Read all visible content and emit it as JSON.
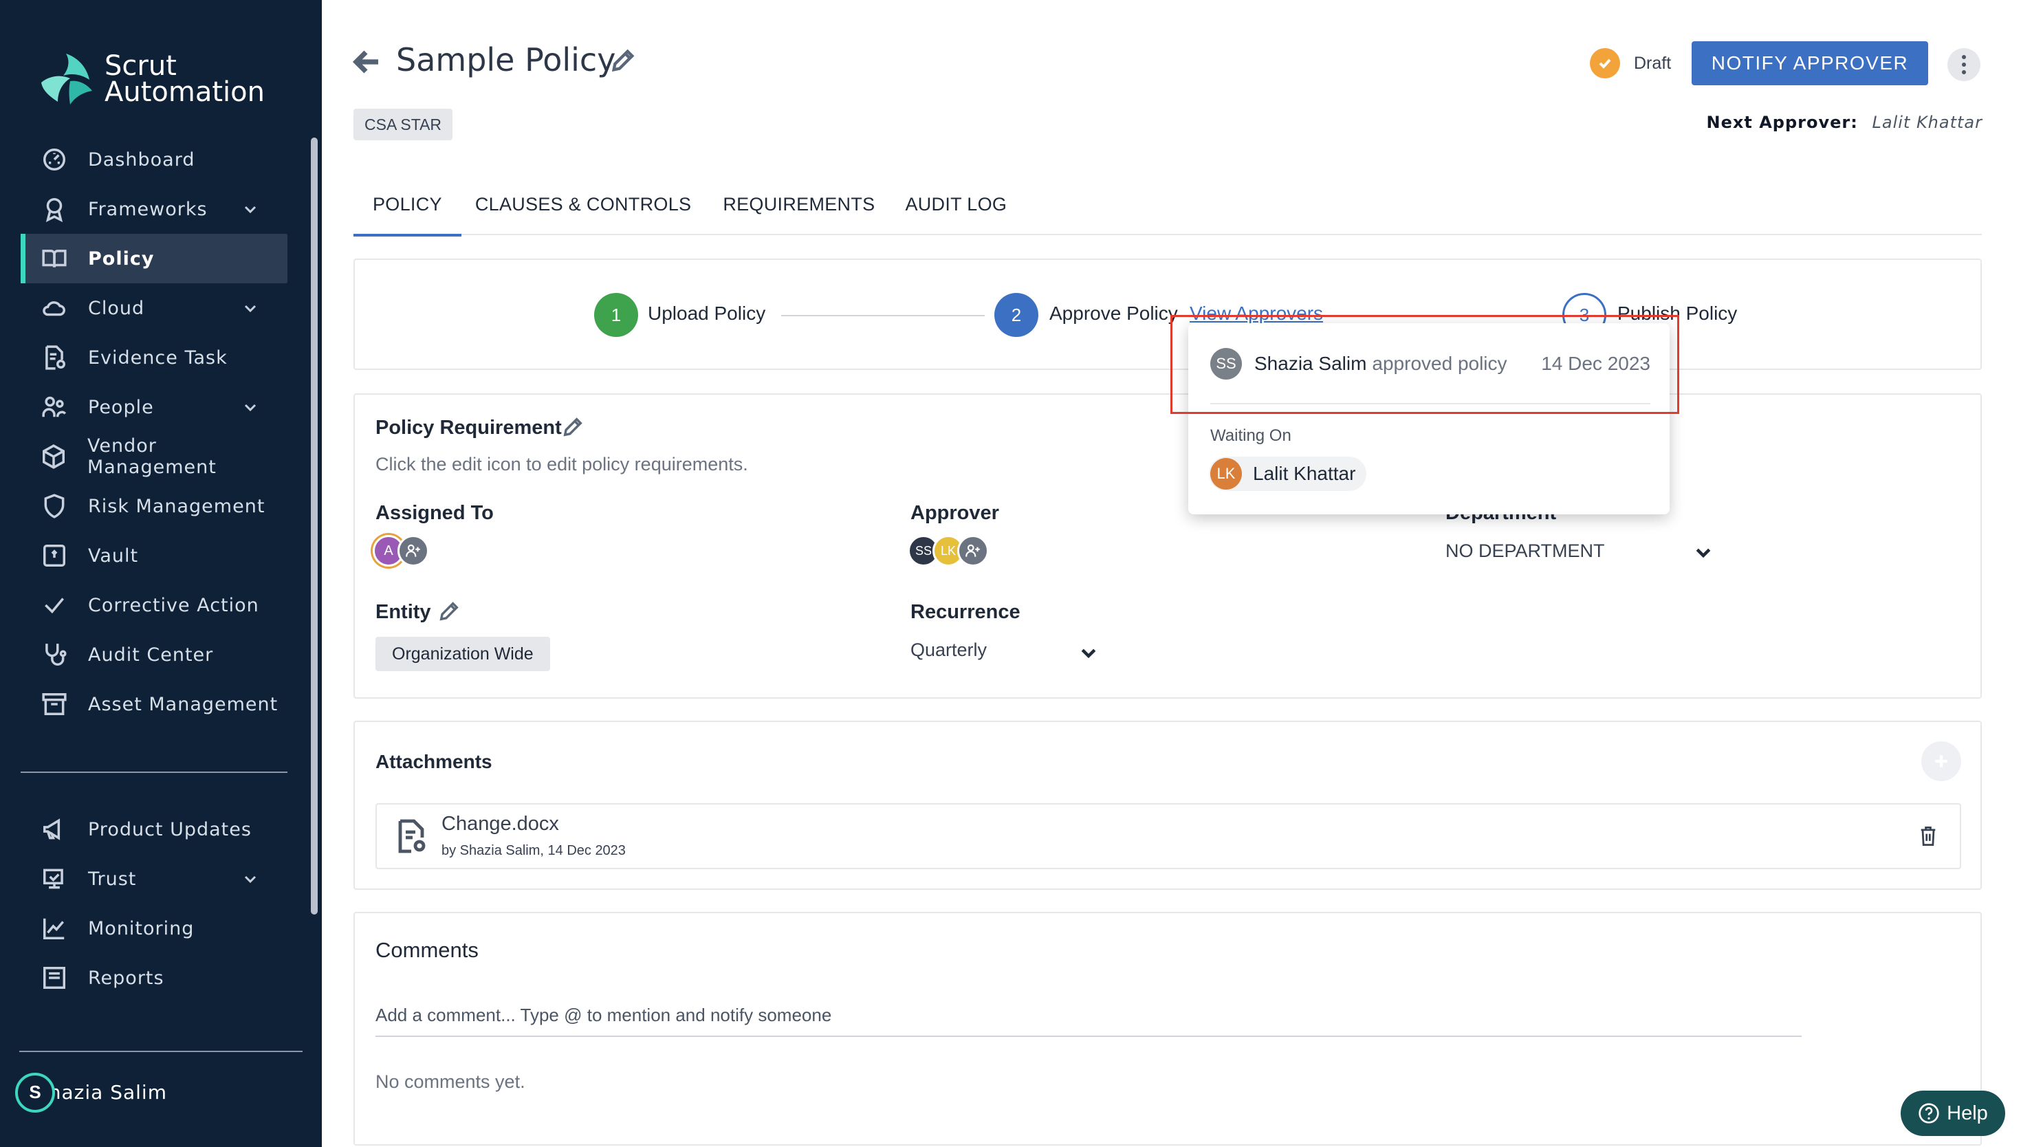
{
  "brand": {
    "line1": "Scrut",
    "line2": "Automation"
  },
  "sidebar": {
    "items": [
      {
        "label": "Dashboard",
        "icon": "dashboard-icon",
        "chevron": false,
        "active": false
      },
      {
        "label": "Frameworks",
        "icon": "award-icon",
        "chevron": true,
        "active": false
      },
      {
        "label": "Policy",
        "icon": "book-icon",
        "chevron": false,
        "active": true
      },
      {
        "label": "Cloud",
        "icon": "cloud-icon",
        "chevron": true,
        "active": false
      },
      {
        "label": "Evidence Task",
        "icon": "file-task-icon",
        "chevron": false,
        "active": false
      },
      {
        "label": "People",
        "icon": "people-icon",
        "chevron": true,
        "active": false
      },
      {
        "label": "Vendor Management",
        "icon": "box-icon",
        "chevron": false,
        "active": false
      },
      {
        "label": "Risk Management",
        "icon": "shield-icon",
        "chevron": false,
        "active": false
      },
      {
        "label": "Vault",
        "icon": "vault-icon",
        "chevron": false,
        "active": false
      },
      {
        "label": "Corrective Action",
        "icon": "check-icon",
        "chevron": false,
        "active": false
      },
      {
        "label": "Audit Center",
        "icon": "stethoscope-icon",
        "chevron": false,
        "active": false
      },
      {
        "label": "Asset Management",
        "icon": "archive-icon",
        "chevron": false,
        "active": false
      }
    ],
    "bottom_items": [
      {
        "label": "Product Updates",
        "icon": "megaphone-icon",
        "chevron": false
      },
      {
        "label": "Trust",
        "icon": "trust-icon",
        "chevron": true
      },
      {
        "label": "Monitoring",
        "icon": "chart-line-icon",
        "chevron": false
      },
      {
        "label": "Reports",
        "icon": "reports-icon",
        "chevron": false
      }
    ],
    "user": {
      "initial": "S",
      "name": "Shazia Salim"
    }
  },
  "header": {
    "title": "Sample Policy",
    "tag": "CSA STAR",
    "status": "Draft",
    "notify_label": "NOTIFY APPROVER",
    "next_approver_label": "Next Approver:",
    "next_approver_value": "Lalit Khattar"
  },
  "tabs": [
    "POLICY",
    "CLAUSES & CONTROLS",
    "REQUIREMENTS",
    "AUDIT LOG"
  ],
  "stepper": {
    "steps": [
      {
        "num": "1",
        "label": "Upload Policy",
        "state": "done",
        "color": "#3fa34d"
      },
      {
        "num": "2",
        "label": "Approve Policy",
        "state": "current",
        "color": "#3b70c3"
      },
      {
        "num": "3",
        "label": "Publish Policy",
        "state": "pending",
        "color": "#3b70c3"
      }
    ],
    "link": "View Approvers"
  },
  "requirement": {
    "title": "Policy Requirement",
    "subtitle": "Click the edit icon to edit policy requirements.",
    "assigned_to_label": "Assigned To",
    "assigned_initial": "A",
    "approver_label": "Approver",
    "approver_initials": [
      "SS",
      "LK"
    ],
    "department_label": "Department",
    "department_value": "NO DEPARTMENT",
    "entity_label": "Entity",
    "entity_value": "Organization Wide",
    "recurrence_label": "Recurrence",
    "recurrence_value": "Quarterly"
  },
  "attachments": {
    "title": "Attachments",
    "file_name": "Change.docx",
    "file_meta": "by Shazia Salim, 14 Dec 2023"
  },
  "comments": {
    "title": "Comments",
    "placeholder": "Add a comment... Type @ to mention and notify someone",
    "empty": "No comments yet."
  },
  "popup": {
    "approved_initials": "SS",
    "approved_name": "Shazia Salim",
    "approved_action": "approved policy",
    "approved_date": "14 Dec 2023",
    "waiting_label": "Waiting On",
    "waiting_initials": "LK",
    "waiting_name": "Lalit Khattar"
  },
  "help_label": "Help"
}
